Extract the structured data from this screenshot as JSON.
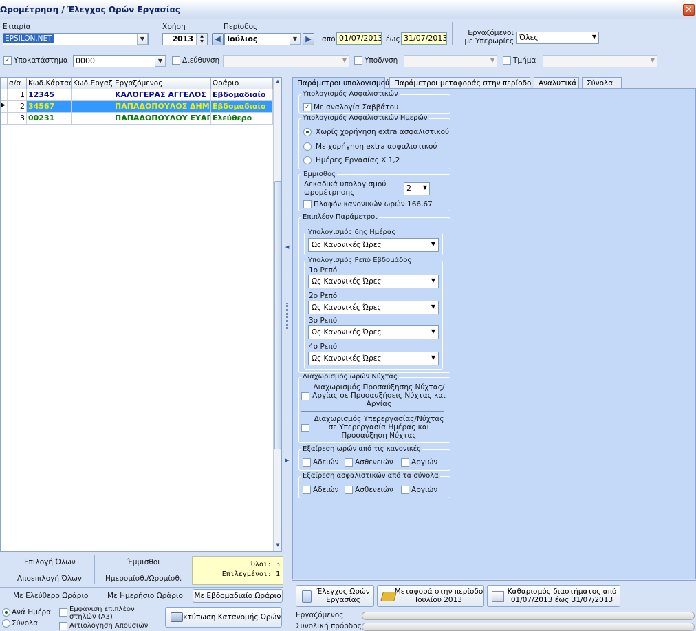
{
  "window": {
    "title": "Ωρομέτρηση / Έλεγχος Ωρών Εργασίας",
    "close": "✕"
  },
  "filters": {
    "company_label": "Εταιρία",
    "company_value": "EPSILON.NET",
    "year_label": "Χρήση",
    "year_value": "2013",
    "period_label": "Περίοδος",
    "period_value": "Ιούλιος",
    "from_label": "από",
    "from_value": "01/07/2013",
    "to_label": "έως",
    "to_value": "31/07/2013",
    "overtime_label": "Εργαζόμενοι με Υπερωρίες",
    "overtime_value": "Όλες",
    "branch_label": "Υποκατάστημα",
    "branch_value": "0000",
    "address_label": "Διεύθυνση",
    "subsection_label": "Υποδ/νση",
    "department_label": "Τμήμα"
  },
  "grid": {
    "columns": [
      "α/α",
      "Κωδ.Κάρτας",
      "Κωδ.Εργαζ.",
      "Εργαζόμενος",
      "Ωράριο"
    ],
    "rows": [
      {
        "aa": "1",
        "card": "12345",
        "code": "",
        "name": "ΚΑΛΟΓΕΡΑΣ ΑΓΓΕΛΟΣ",
        "schedule": "Εβδομαδιαίο",
        "selected": false,
        "color": "#0b0b9a"
      },
      {
        "aa": "2",
        "card": "34567",
        "code": "",
        "name": "ΠΑΠΑΔΟΠΟΥΛΟΣ ΔΗΜΗΤ",
        "schedule": "Εβδομαδιαίο",
        "selected": true,
        "color": "#f0f000"
      },
      {
        "aa": "3",
        "card": "00231",
        "code": "",
        "name": "ΠΑΠΑΔΟΠΟΥΛΟΥ ΕΥΑΓΓ",
        "schedule": "Ελεύθερο",
        "selected": false,
        "color": "#0a7a0a"
      }
    ]
  },
  "bottom_left": {
    "select_all": "Επιλογή Όλων",
    "deselect_all": "Αποεπιλογή Όλων",
    "salaried": "Έμμισθοι",
    "daily_hourly": "Ημερομίσθ./Ωρομίσθ.",
    "free_schedule": "Με Ελεύθερο Ωράριο",
    "daily_schedule": "Με Ημερήσιο Ωράριο",
    "weekly_schedule": "Με Εβδομαδιαίο Ωράριο",
    "info_text": "Όλοι: 3\nΕπιλεγμένοι: 1",
    "per_day": "Ανά Ημέρα",
    "totals": "Σύνολα",
    "show_extra_columns": "Εμφάνιση επιπλέον στηλών (A3)",
    "absence_justification": "Αιτιολόγηση Απουσιών",
    "print_button": "Εκτύπωση Κατανομής Ωρών"
  },
  "tabs": [
    "Παράμετροι υπολογισμού",
    "Παράμετροι μεταφοράς στην περίοδο",
    "Αναλυτικά",
    "Σύνολα"
  ],
  "params": {
    "insurance_group": "Υπολογισμός Ασφαλιστικών",
    "saturday_ratio": "Με αναλογία Σαββάτου",
    "insurance_days_group": "Υπολογισμός Ασφαλιστικών Ημερών",
    "no_extra": "Χωρίς χορήγηση extra ασφαλιστικού",
    "with_extra": "Με χορήγηση extra ασφαλιστικού",
    "work_days": "Ημέρες Εργασίας Χ 1,2",
    "salaried_group": "Έμμισθος",
    "decimals_label": "Δεκαδικά υπολογισμού ωρομέτρησης",
    "decimals_value": "2",
    "ceiling_label": "Πλαφόν κανονικών ωρών 166,67",
    "extra_group": "Επιπλέον Παράμετροι",
    "sixth_day_group": "Υπολογισμός 6ης Ημέρας",
    "sixth_day_value": "Ως Κανονικές Ώρες",
    "weekly_rest_group": "Υπολογισμός Ρεπό Εβδομάδος",
    "rest1_label": "1ο Ρεπό",
    "rest1_value": "Ως Κανονικές Ώρες",
    "rest2_label": "2ο Ρεπό",
    "rest2_value": "Ως Κανονικές Ώρες",
    "rest3_label": "3ο Ρεπό",
    "rest3_value": "Ως Κανονικές Ώρες",
    "rest4_label": "4ο Ρεπό",
    "rest4_value": "Ως Κανονικές Ώρες",
    "night_group": "Διαχωρισμός ωρών Νύχτας",
    "night_opt1": "Διαχωρισμός Προσαύξησης Νύχτας/Αργίας σε Προσαυξήσεις Νύχτας και Αργίας",
    "night_opt2": "Διαχωρισμός Υπερεργασίας/Νύχτας σε Υπερεργασία Ημέρας και Προσαύξηση Νύχτας",
    "exclude_hours_group": "Εξαίρεση ωρών από τις κανονικές",
    "exclude_ins_group": "Εξαίρεση ασφαλιστικών από τα σύνολα",
    "leaves": "Αδειών",
    "sick": "Ασθενειών",
    "holidays": "Αργιών"
  },
  "actions": {
    "check_hours": "Έλεγχος Ωρών Εργασίας",
    "transfer": "Μεταφορά στην περίοδο Ιουλίου 2013",
    "clear": "Καθαρισμός διαστήματος από 01/07/2013 έως 31/07/2013"
  },
  "progress": {
    "employee_label": "Εργαζόμενος",
    "total_label": "Συνολική πρόοδος"
  }
}
